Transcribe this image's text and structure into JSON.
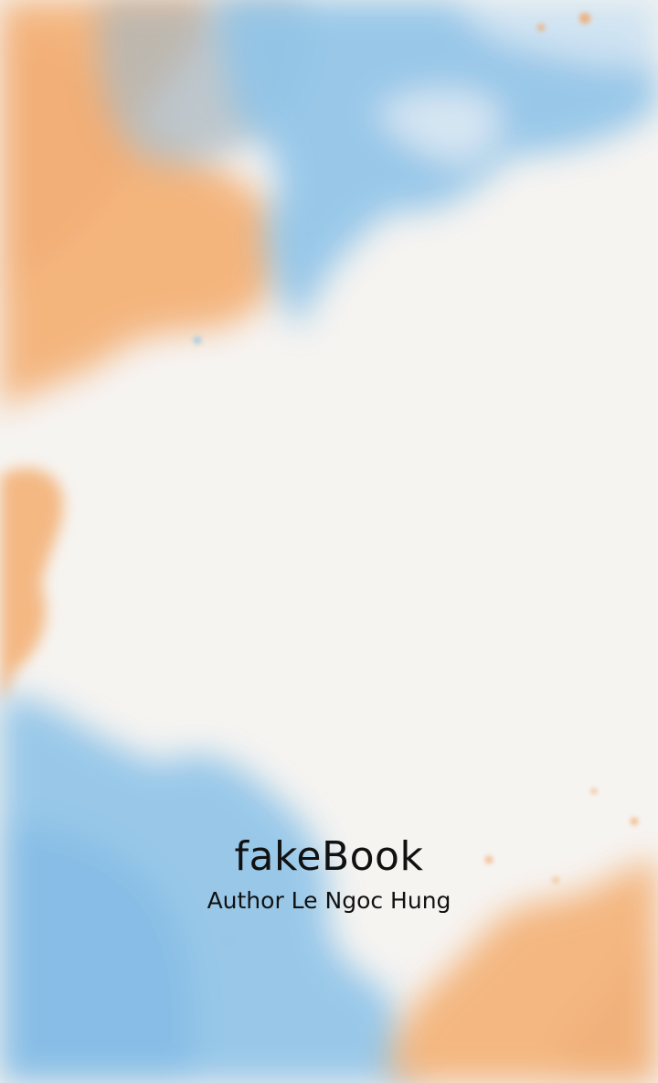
{
  "splash": {
    "title": "fakeBook",
    "subtitle": "Author Le Ngoc Hung"
  },
  "background": {
    "type": "watercolor-paper",
    "colors": {
      "paper": "#f8f7f4",
      "orange": "#f6b173",
      "blue": "#8cc4ea",
      "grey_blue": "#a9b7bf"
    }
  }
}
